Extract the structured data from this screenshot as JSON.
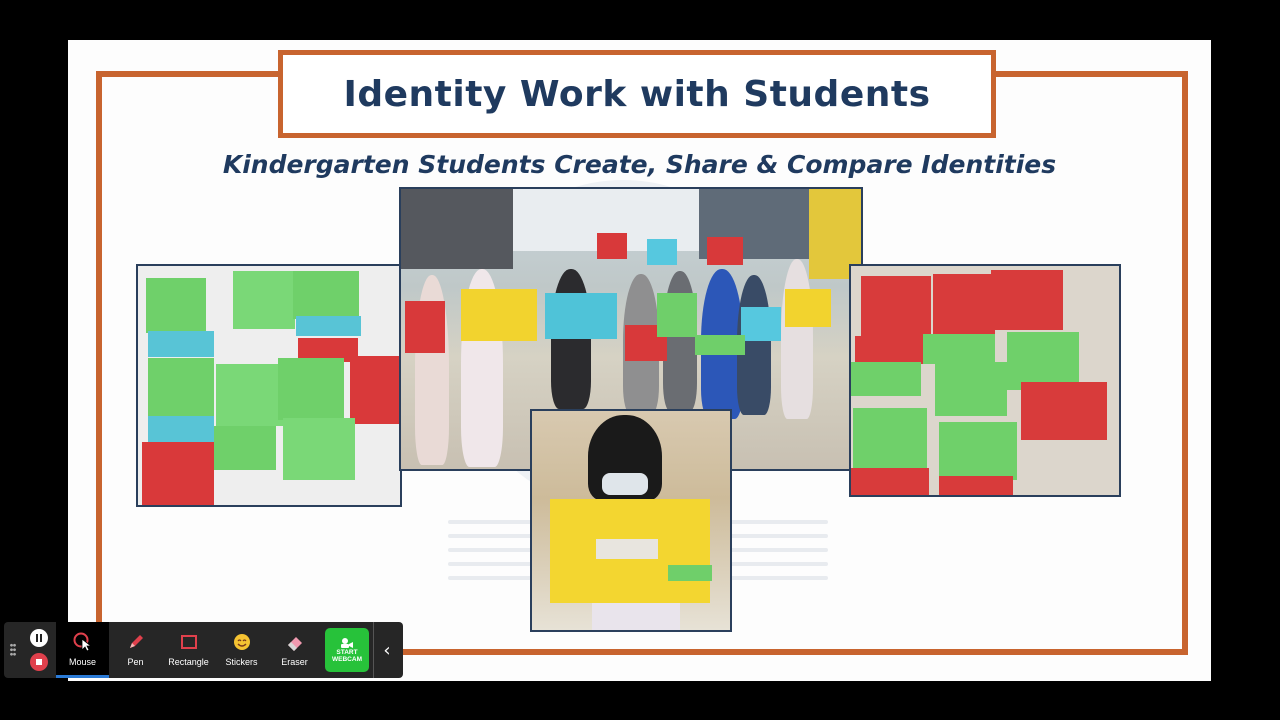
{
  "slide": {
    "title": "Identity Work with Students",
    "subtitle": "Kindergarten Students Create, Share & Compare Identities"
  },
  "photos": [
    {
      "name": "sticky-notes-board-photo"
    },
    {
      "name": "classroom-group-photo"
    },
    {
      "name": "red-green-notes-photo"
    },
    {
      "name": "student-holding-notes-photo"
    }
  ],
  "toolbar": {
    "tools": [
      {
        "label": "Mouse",
        "icon": "mouse-cursor-icon",
        "active": true
      },
      {
        "label": "Pen",
        "icon": "pen-icon"
      },
      {
        "label": "Rectangle",
        "icon": "rectangle-icon"
      },
      {
        "label": "Stickers",
        "icon": "sticker-icon"
      },
      {
        "label": "Eraser",
        "icon": "eraser-icon"
      }
    ],
    "webcam_line1": "START",
    "webcam_line2": "WEBCAM",
    "collapse": "‹"
  },
  "colors": {
    "accent_orange": "#c8642f",
    "title_navy": "#1f3a5f",
    "webcam_green": "#27c23a",
    "stop_red": "#e0404c"
  }
}
